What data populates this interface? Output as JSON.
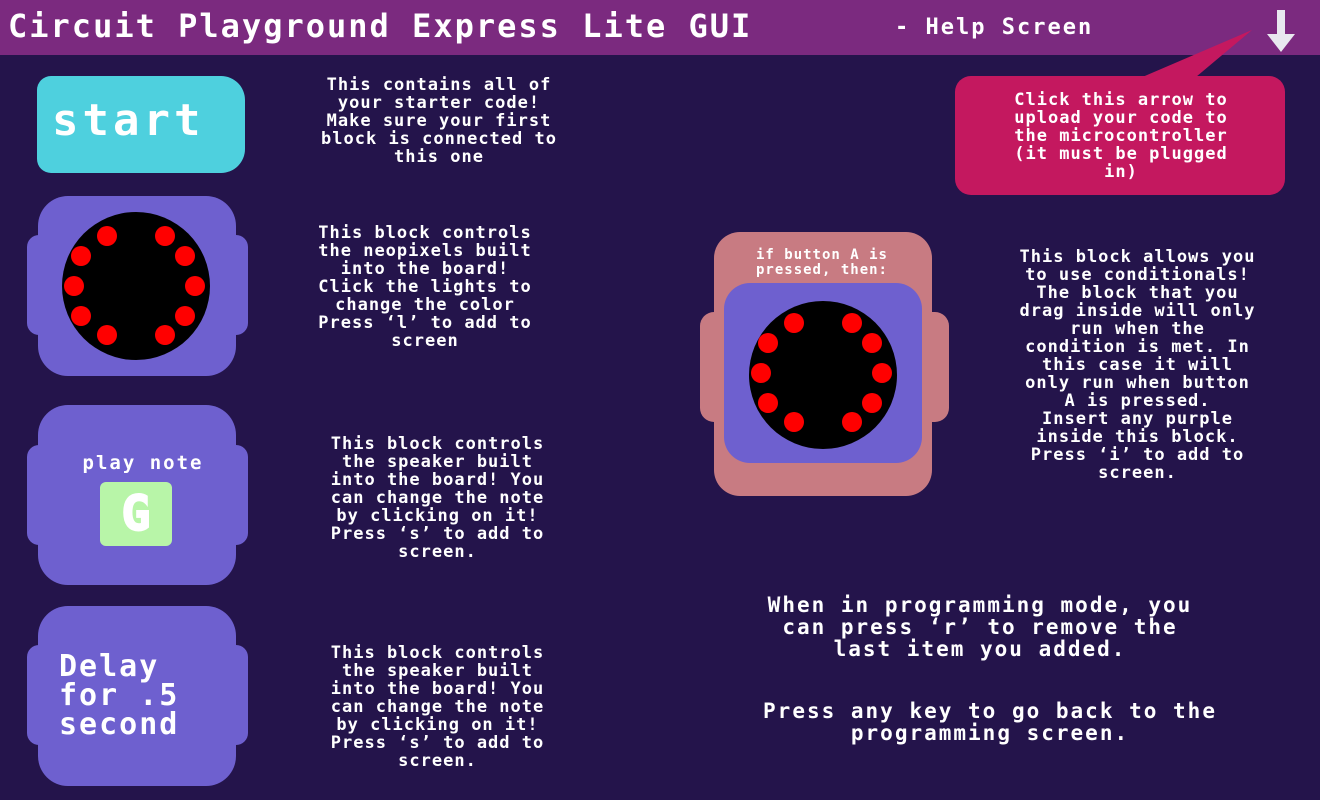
{
  "header": {
    "title": "Circuit Playground Express Lite GUI",
    "subtitle": "- Help Screen",
    "upload_icon": "down-arrow-icon"
  },
  "colors": {
    "background": "#24144b",
    "titlebar": "#7b2a7f",
    "start_block": "#4ed0de",
    "purple_block": "#6e60cf",
    "conditional_block": "#c87b82",
    "callout": "#c4185f",
    "note_box": "#b8f5a8",
    "neopixel_led": "#ff0000"
  },
  "blocks": {
    "start": {
      "label": "start",
      "description": "This contains all of\nyour starter code!\nMake sure your first\nblock is connected to\nthis one"
    },
    "neopixel": {
      "description": "This block controls\nthe neopixels built\ninto the board!\nClick the lights to\nchange the color\nPress ‘l’ to add to\nscreen"
    },
    "play_note": {
      "label": "play note",
      "note": "G",
      "description": "This block controls\nthe speaker built\ninto the board! You\ncan change the note\nby clicking on it!\nPress ‘s’ to add to\nscreen."
    },
    "delay": {
      "label": "Delay\nfor .5\nsecond",
      "description": "This block controls\nthe speaker built\ninto the board! You\ncan change the note\nby clicking on it!\nPress ‘s’ to add to\nscreen."
    },
    "conditional": {
      "label": "if button A is\npressed, then:",
      "description": "This block allows you\nto use conditionals!\nThe block that you\ndrag inside will only\nrun when the\ncondition is met. In\nthis case it will\nonly run when button\nA is pressed.\nInsert any purple\ninside this block.\nPress ‘i’ to add to\nscreen."
    }
  },
  "callout": {
    "text": "Click this arrow to\nupload your code to\nthe microcontroller\n(it must be plugged\nin)"
  },
  "notes": {
    "programming_mode": "When in programming mode, you\ncan press ‘r’ to remove the\nlast item you added.",
    "go_back": "Press any key to go back to the\nprogramming  screen."
  }
}
